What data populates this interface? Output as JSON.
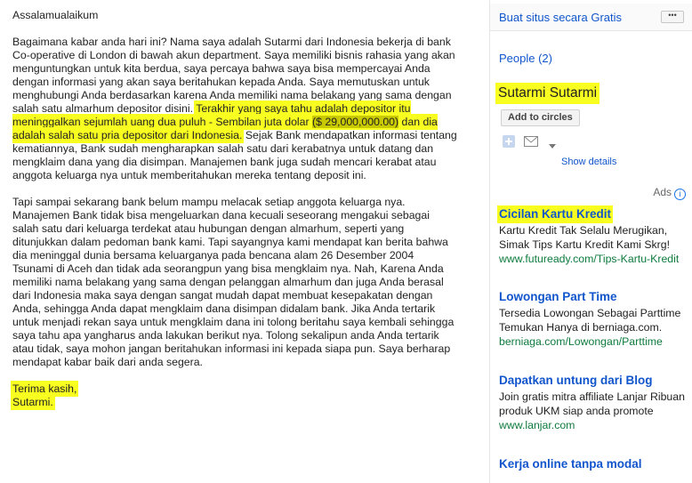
{
  "letter": {
    "greeting": "Assalamualaikum",
    "p1_a": "Bagaimana kabar anda hari ini? Nama saya adalah Sutarmi dari Indonesia bekerja di bank Co-operative di London di bawah akun department. Saya memiliki bisnis rahasia yang akan menguntungkan untuk kita berdua, saya percaya bahwa saya bisa mempercayai Anda dengan informasi yang akan saya beritahukan kepada Anda. Saya memutuskan untuk menghubungi Anda berdasarkan karena Anda memiliki nama belakang yang sama dengan salah satu almarhum depositor disini. ",
    "p1_hl1": "Terakhir yang saya tahu adalah depositor itu meninggalkan sejumlah uang dua puluh - Sembilan juta dolar",
    "p1_amount": "($ 29,000,000.00)",
    "p1_hl2": "dan dia adalah salah satu pria depositor dari Indonesia.",
    "p1_b": " Sejak Bank  mendapatkan informasi tentang kematiannya, Bank sudah mengharapkan salah satu dari kerabatnya untuk datang dan mengklaim dana yang dia disimpan. Manajemen bank juga sudah mencari kerabat atau anggota keluarga nya untuk memberitahukan mereka tentang deposit ini.",
    "p2": "Tapi sampai sekarang bank belum mampu melacak setiap anggota keluarga nya. Manajemen Bank tidak bisa mengeluarkan dana kecuali seseorang mengakui sebagai salah satu dari keluarga terdekat atau hubungan dengan almarhum, seperti yang ditunjukkan dalam pedoman bank kami. Tapi sayangnya kami mendapat kan berita bahwa dia meninggal dunia bersama keluarganya pada bencana alam 26 Desember 2004 Tsunami di Aceh dan tidak ada seorangpun yang bisa mengklaim nya. Nah, Karena Anda memiliki nama belakang yang sama dengan pelanggan almarhum dan juga Anda berasal dari Indonesia maka saya dengan sangat mudah dapat membuat kesepakatan dengan Anda, sehingga Anda dapat mengklaim dana disimpan didalam bank. Jika Anda tertarik untuk menjadi rekan saya untuk mengklaim dana ini tolong beritahu saya kembali sehingga saya tahu apa yangharus anda lakukan berikut nya. Tolong sekalipun anda Anda tertarik atau tidak, saya mohon jangan beritahukan informasi ini kepada siapa pun. Saya berharap mendapat kabar baik dari anda segera.",
    "closing": "Terima kasih,",
    "signature": "Sutarmi."
  },
  "sidebar": {
    "create_site": "Buat situs secara Gratis",
    "more_label": "•••",
    "people": "People (2)",
    "profile_name": "Sutarmi Sutarmi",
    "add_to_circles": "Add to circles",
    "show_details": "Show details",
    "ads_label": "Ads",
    "ads_info_glyph": "i"
  },
  "ads": [
    {
      "title": "Cicilan Kartu Kredit",
      "body": "Kartu Kredit Tak Selalu Merugikan, Simak Tips Kartu Kredit Kami Skrg!",
      "url": "www.futuready.com/Tips-Kartu-Kredit"
    },
    {
      "title": "Lowongan Part Time",
      "body": "Tersedia Lowongan Sebagai Parttime",
      "body2": "Temukan Hanya di berniaga.com.",
      "url": "berniaga.com/Lowongan/Parttime"
    },
    {
      "title": "Dapatkan untung dari Blog",
      "body": "Join gratis mitra affiliate Lanjar Ribuan produk UKM siap anda promote",
      "url": "www.lanjar.com"
    },
    {
      "title": "Kerja online tanpa modal"
    }
  ],
  "colors": {
    "highlight": "#f8ff20",
    "link": "#1155cc",
    "ad_url": "#0e7b3d"
  },
  "icons": {
    "gplus": "plus-icon",
    "mail": "mail-icon",
    "dropdown": "chevron-down-icon",
    "info": "info-icon"
  }
}
